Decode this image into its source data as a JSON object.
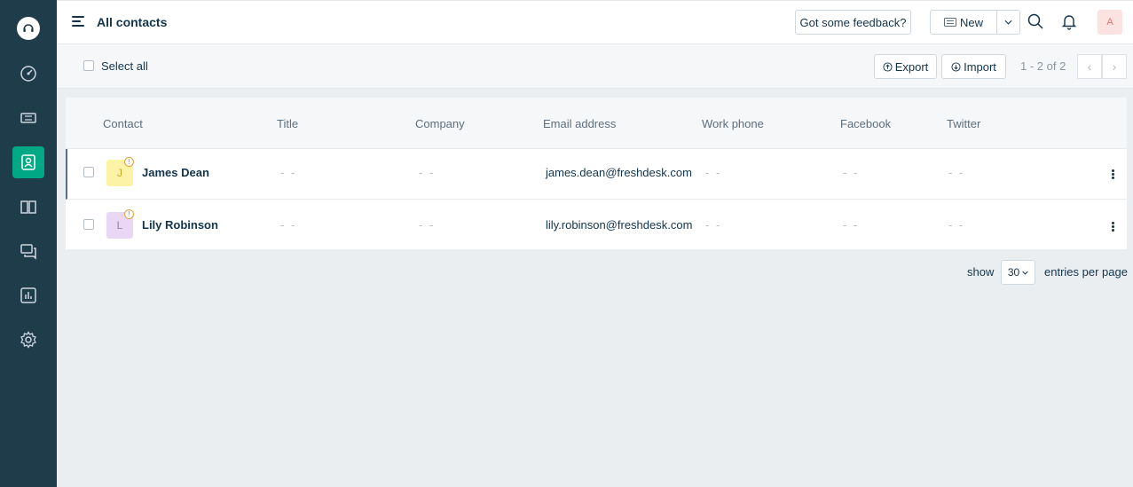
{
  "header": {
    "title": "All contacts",
    "feedback_label": "Got some feedback?",
    "new_label": "New",
    "avatar_initial": "A"
  },
  "sidebar": {
    "items": [
      {
        "icon": "dashboard-icon",
        "active": false
      },
      {
        "icon": "tickets-icon",
        "active": false
      },
      {
        "icon": "contacts-icon",
        "active": true
      },
      {
        "icon": "solutions-book-icon",
        "active": false
      },
      {
        "icon": "forums-icon",
        "active": false
      },
      {
        "icon": "reports-icon",
        "active": false
      },
      {
        "icon": "settings-gear-icon",
        "active": false
      }
    ]
  },
  "toolbar": {
    "select_all_label": "Select all",
    "export_label": "Export",
    "import_label": "Import",
    "pagination_text": "1 - 2 of 2"
  },
  "table": {
    "columns": [
      "Contact",
      "Title",
      "Company",
      "Email address",
      "Work phone",
      "Facebook",
      "Twitter"
    ],
    "rows": [
      {
        "initial": "J",
        "name": "James Dean",
        "title": "- -",
        "company": "- -",
        "email": "james.dean@freshdesk.com",
        "work_phone": "- -",
        "facebook": "- -",
        "twitter": "- -",
        "avatar_bg": "#fdf3a7",
        "avatar_fg": "#c9a227"
      },
      {
        "initial": "L",
        "name": "Lily Robinson",
        "title": "- -",
        "company": "- -",
        "email": "lily.robinson@freshdesk.com",
        "work_phone": "- -",
        "facebook": "- -",
        "twitter": "- -",
        "avatar_bg": "#ead7f5",
        "avatar_fg": "#9c7bb0"
      }
    ]
  },
  "footer": {
    "show_label": "show",
    "per_page_value": "30",
    "entries_label": "entries per page"
  },
  "colors": {
    "sidebar_bg": "#1f3c4b",
    "accent": "#00a886"
  }
}
